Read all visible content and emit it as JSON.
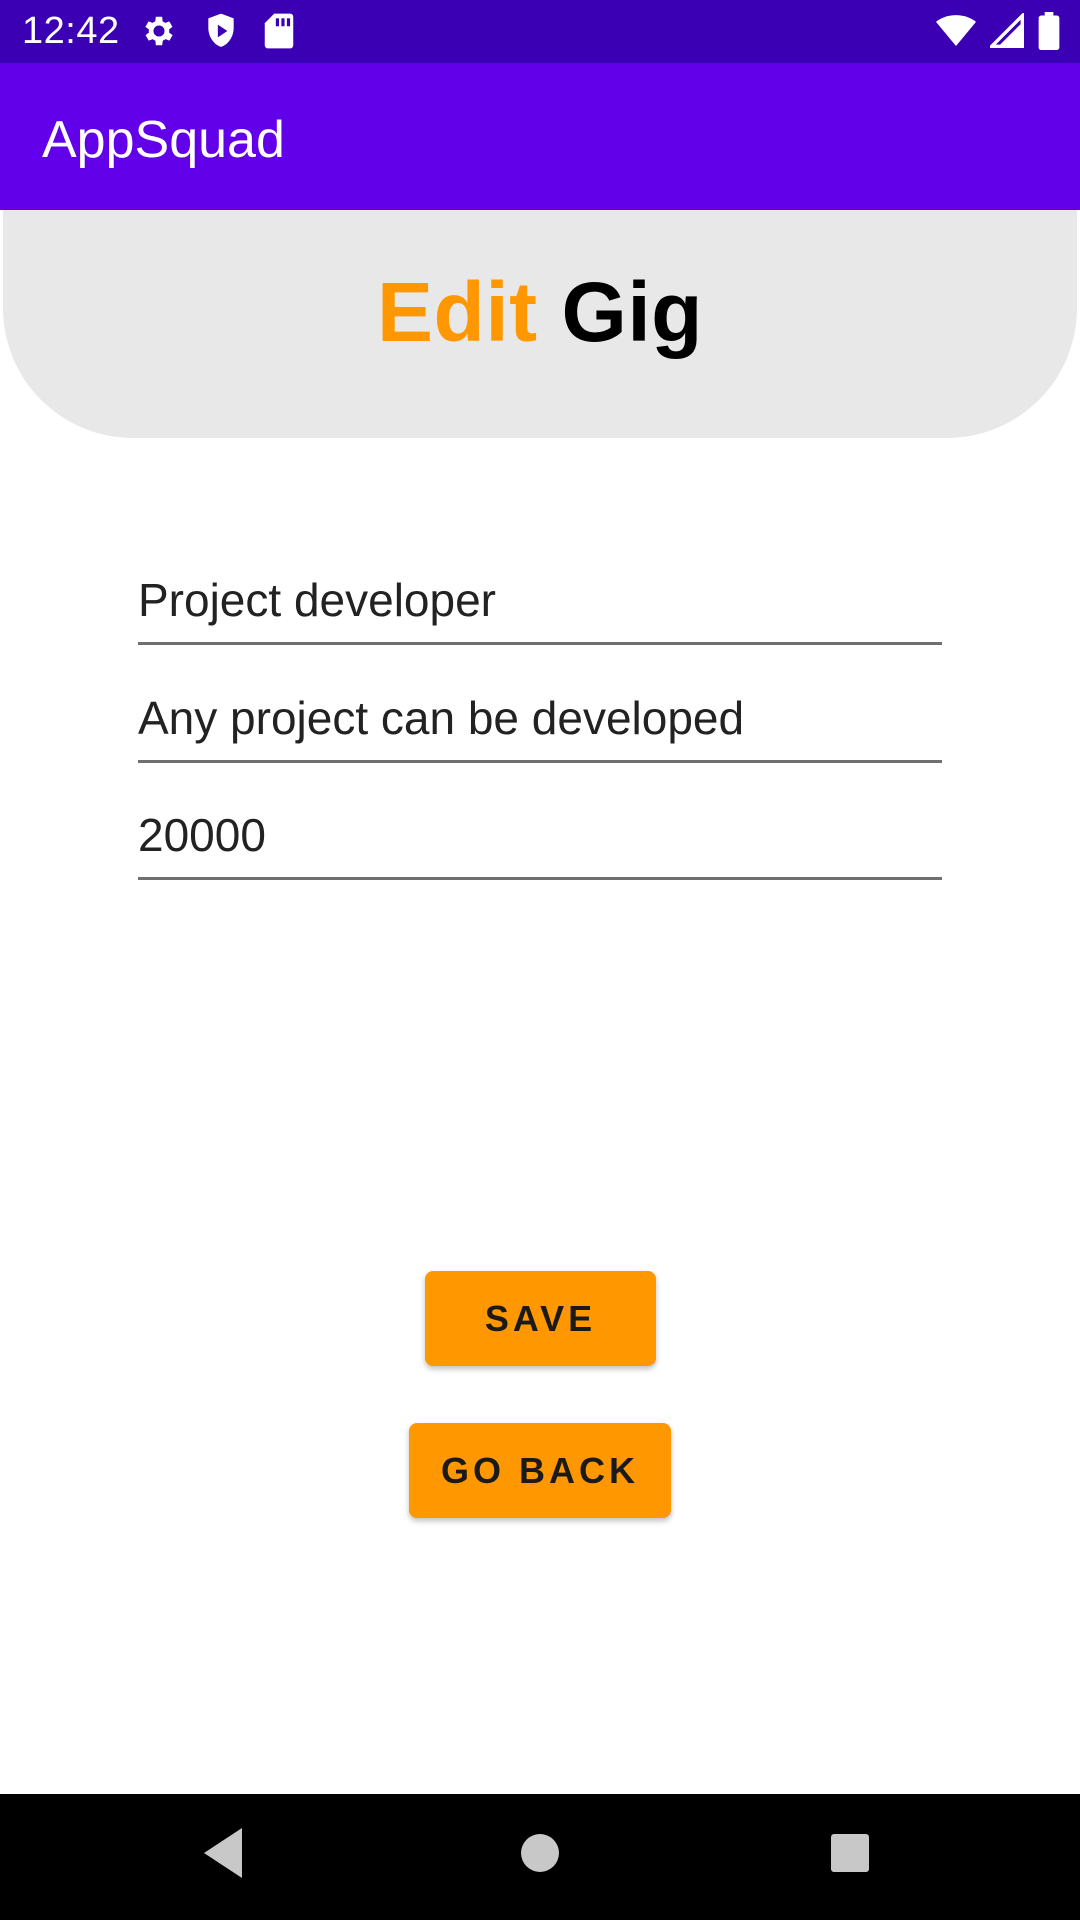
{
  "status_bar": {
    "time": "12:42",
    "left_icons": [
      "settings-icon",
      "shield-icon",
      "sd-card-icon"
    ],
    "right_icons": [
      "wifi-icon",
      "cellular-signal-icon",
      "battery-icon"
    ],
    "background": "#3b00b3"
  },
  "app_bar": {
    "title": "AppSquad",
    "background": "#6200ea"
  },
  "header": {
    "title_accent": "Edit",
    "title_main": "Gig",
    "accent_color": "#ff9800"
  },
  "form": {
    "gig_title": "Project developer",
    "gig_description": "Any project can be developed",
    "gig_price": "20000"
  },
  "buttons": {
    "save_label": "SAVE",
    "go_back_label": "GO BACK",
    "color": "#ff9800"
  },
  "nav_bar": {
    "icons": [
      "back-icon",
      "home-icon",
      "recents-icon"
    ]
  }
}
